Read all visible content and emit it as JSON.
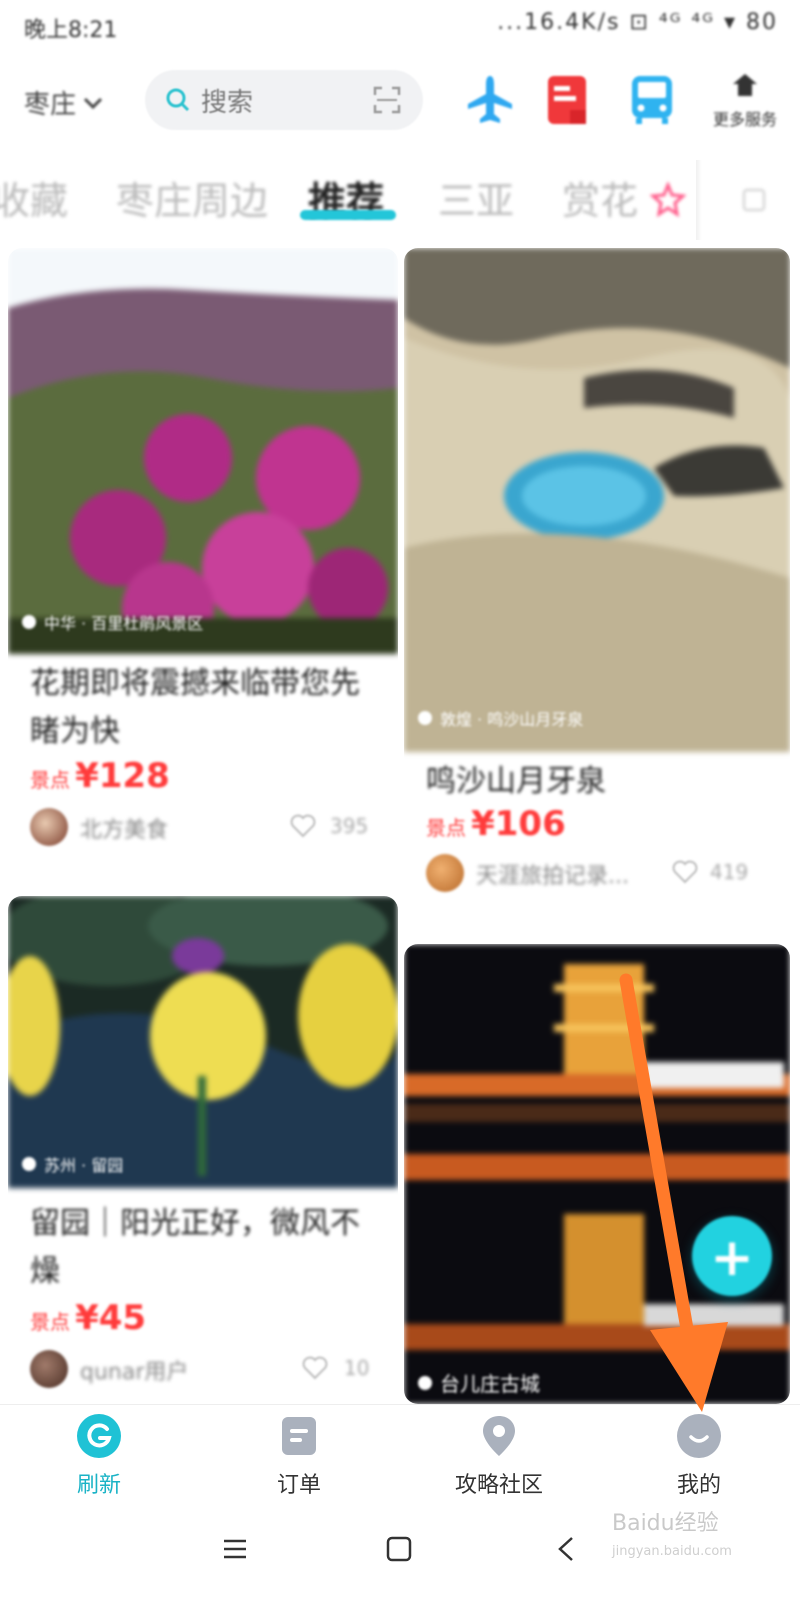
{
  "status_bar": {
    "time": "晚上8:21",
    "indicators": "...16.4K/s ⊡ ⁴ᴳ ⁴ᴳ ▾ 80"
  },
  "header": {
    "city": "枣庄",
    "search_placeholder": "搜索",
    "icons": [
      "plane-icon",
      "train-ticket-icon",
      "bus-icon"
    ],
    "more_label": "更多服务"
  },
  "tabs": {
    "items": [
      "收藏",
      "枣庄周边",
      "推荐",
      "三亚",
      "赏花"
    ],
    "active": "推荐"
  },
  "feed": {
    "cards": [
      {
        "caption": "中华 · 百里杜鹃风景区",
        "title": "花期即将震撼来临带您先睹为快",
        "price_label": "景点",
        "price": "¥128",
        "user": "北方美食",
        "likes": "395"
      },
      {
        "caption": "敦煌 · 鸣沙山月牙泉",
        "title": "鸣沙山月牙泉",
        "price_label": "景点",
        "price": "¥106",
        "user": "天涯旅拍记录...",
        "likes": "419"
      },
      {
        "caption": "苏州 · 留园",
        "title": "留园｜阳光正好，微风不燥",
        "price_label": "景点",
        "price": "¥45",
        "user": "qunar用户",
        "likes": "10"
      },
      {
        "caption": "台儿庄古城",
        "title": "",
        "price_label": "",
        "price": "",
        "user": "",
        "likes": ""
      }
    ],
    "fab_symbol": "+"
  },
  "bottom_nav": {
    "items": [
      {
        "label": "刷新",
        "icon": "refresh-icon",
        "active": true
      },
      {
        "label": "订单",
        "icon": "order-icon",
        "active": false
      },
      {
        "label": "攻略社区",
        "icon": "location-pin-icon",
        "active": false
      },
      {
        "label": "我的",
        "icon": "profile-icon",
        "active": false
      }
    ]
  },
  "system_nav": [
    "menu-icon",
    "home-icon",
    "back-icon"
  ],
  "watermark": {
    "main": "Baidu经验",
    "sub": "jingyan.baidu.com"
  },
  "colors": {
    "accent": "#1ab3c6",
    "price": "#ff3b3b",
    "fab": "#22d2e0",
    "annotation": "#ff7a2a"
  }
}
